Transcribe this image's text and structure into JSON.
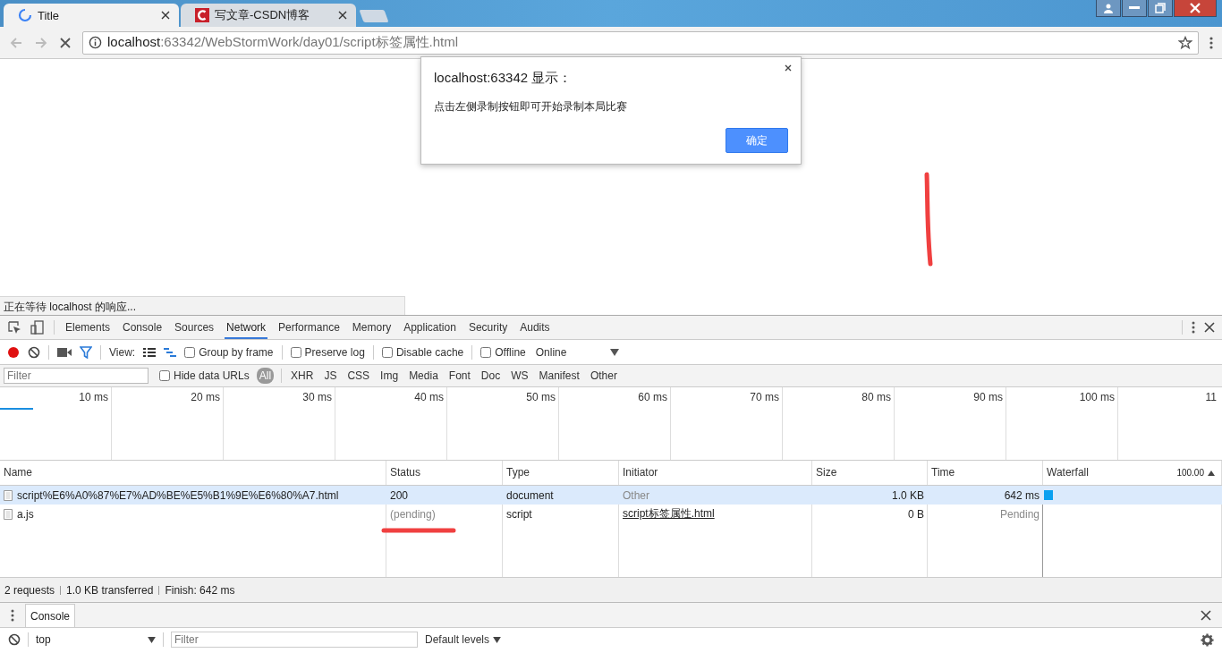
{
  "browser": {
    "tabs": [
      {
        "title": "Title",
        "selected": true,
        "kind": "loading"
      },
      {
        "title": "写文章-CSDN博客",
        "selected": false,
        "kind": "site"
      }
    ],
    "address": {
      "host": "localhost",
      "path": ":63342/WebStormWork/day01/script标签属性.html"
    },
    "loading": true
  },
  "dialog": {
    "title": "localhost:63342 显示：",
    "message": "点击左侧录制按钮即可开始录制本局比赛",
    "button": "确定"
  },
  "status_text": "正在等待 localhost 的响应...",
  "devtools": {
    "panel_tabs": [
      {
        "label": "Elements",
        "selected": false
      },
      {
        "label": "Console",
        "selected": false
      },
      {
        "label": "Sources",
        "selected": false
      },
      {
        "label": "Network",
        "selected": true
      },
      {
        "label": "Performance",
        "selected": false
      },
      {
        "label": "Memory",
        "selected": false
      },
      {
        "label": "Application",
        "selected": false
      },
      {
        "label": "Security",
        "selected": false
      },
      {
        "label": "Audits",
        "selected": false
      }
    ],
    "recording": true,
    "filter_active": true,
    "view_label": "View:",
    "options": [
      {
        "label": "Group by frame",
        "checked": false
      },
      {
        "label": "Preserve log",
        "checked": false
      },
      {
        "label": "Disable cache",
        "checked": false
      },
      {
        "label": "Offline",
        "checked": false
      }
    ],
    "throttling": "Online",
    "filter": {
      "placeholder": "Filter",
      "hide_data_urls": {
        "label": "Hide data URLs",
        "checked": false
      },
      "types": [
        {
          "label": "All",
          "selected": true
        },
        {
          "label": "XHR",
          "selected": false
        },
        {
          "label": "JS",
          "selected": false
        },
        {
          "label": "CSS",
          "selected": false
        },
        {
          "label": "Img",
          "selected": false
        },
        {
          "label": "Media",
          "selected": false
        },
        {
          "label": "Font",
          "selected": false
        },
        {
          "label": "Doc",
          "selected": false
        },
        {
          "label": "WS",
          "selected": false
        },
        {
          "label": "Manifest",
          "selected": false
        },
        {
          "label": "Other",
          "selected": false
        }
      ]
    },
    "timeline_ticks": [
      "10 ms",
      "20 ms",
      "30 ms",
      "40 ms",
      "50 ms",
      "60 ms",
      "70 ms",
      "80 ms",
      "90 ms",
      "100 ms",
      "11"
    ],
    "columns": [
      "Name",
      "Status",
      "Type",
      "Initiator",
      "Size",
      "Time",
      "Waterfall"
    ],
    "waterfall_scale": "100.00",
    "rows": [
      {
        "name": "script%E6%A0%87%E7%AD%BE%E5%B1%9E%E6%80%A7.html",
        "status": "200",
        "type": "document",
        "initiator": {
          "text": "Other",
          "kind": "other"
        },
        "size": "1.0 KB",
        "time": "642 ms",
        "pending": false,
        "selected": true
      },
      {
        "name": "a.js",
        "status": "(pending)",
        "type": "script",
        "initiator": {
          "text": "script标签属性.html",
          "kind": "link"
        },
        "size": "0 B",
        "time": "Pending",
        "pending": true,
        "selected": false
      }
    ],
    "summary": [
      "2 requests",
      "1.0 KB transferred",
      "Finish: 642 ms"
    ],
    "drawer_tab": "Console",
    "console": {
      "context": "top",
      "filter_placeholder": "Filter",
      "levels": "Default levels"
    }
  }
}
